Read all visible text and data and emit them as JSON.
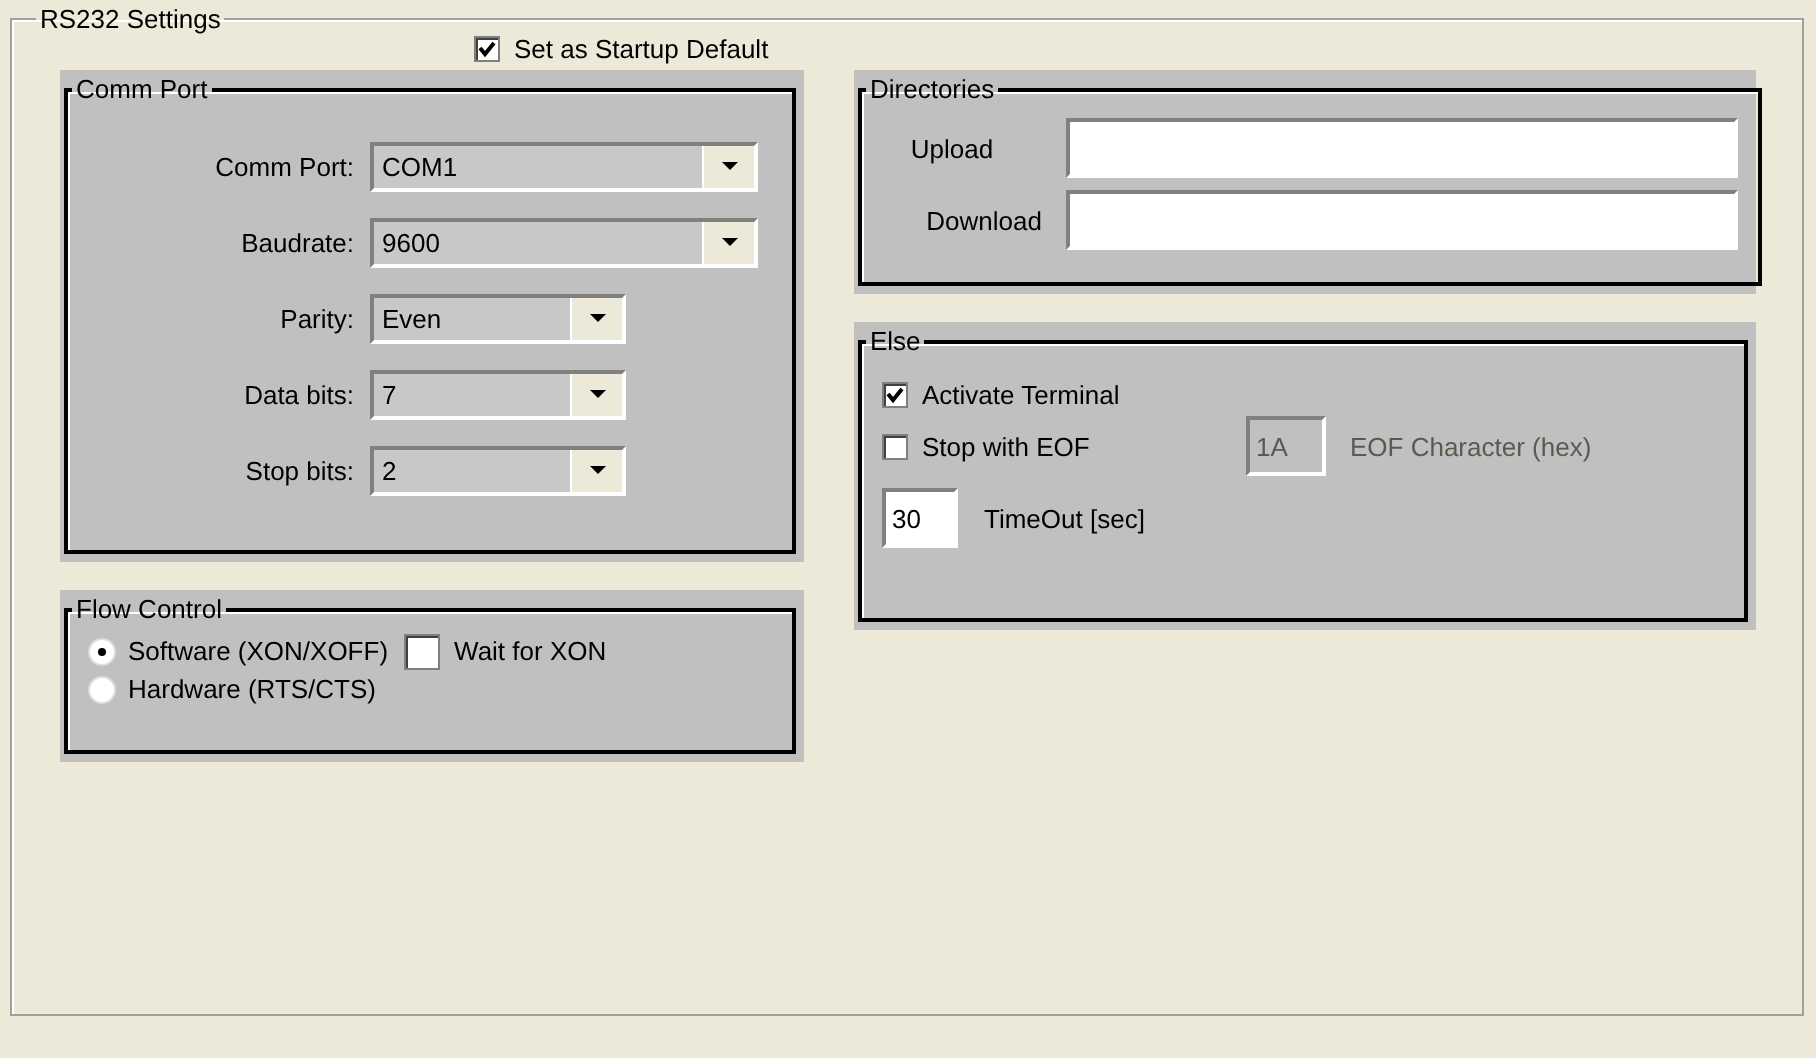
{
  "settings": {
    "title": "RS232 Settings",
    "startup_default": {
      "label": "Set  as Startup Default",
      "checked": true
    }
  },
  "comm_port": {
    "title": "Comm Port",
    "fields": [
      {
        "label": "Comm Port:",
        "value": "COM1"
      },
      {
        "label": "Baudrate:",
        "value": "9600"
      },
      {
        "label": "Parity:",
        "value": "Even"
      },
      {
        "label": "Data bits:",
        "value": "7"
      },
      {
        "label": "Stop bits:",
        "value": "2"
      }
    ]
  },
  "flow_control": {
    "title": "Flow Control",
    "options": [
      {
        "label": "Software (XON/XOFF)",
        "selected": true
      },
      {
        "label": "Hardware (RTS/CTS)",
        "selected": false
      }
    ],
    "wait_for_xon": {
      "label": "Wait for XON",
      "checked": false
    }
  },
  "directories": {
    "title": "Directories",
    "fields": [
      {
        "label": "Upload"
      },
      {
        "label": "Download"
      }
    ]
  },
  "else": {
    "title": "Else",
    "activate_terminal": {
      "label": "Activate Terminal",
      "checked": true
    },
    "stop_with_eof": {
      "label": "Stop with  EOF",
      "checked": false
    },
    "eof_character": {
      "value": "1A",
      "label": "EOF Character (hex)",
      "disabled": true
    },
    "timeout": {
      "value": "30",
      "label": "TimeOut [sec]"
    }
  }
}
